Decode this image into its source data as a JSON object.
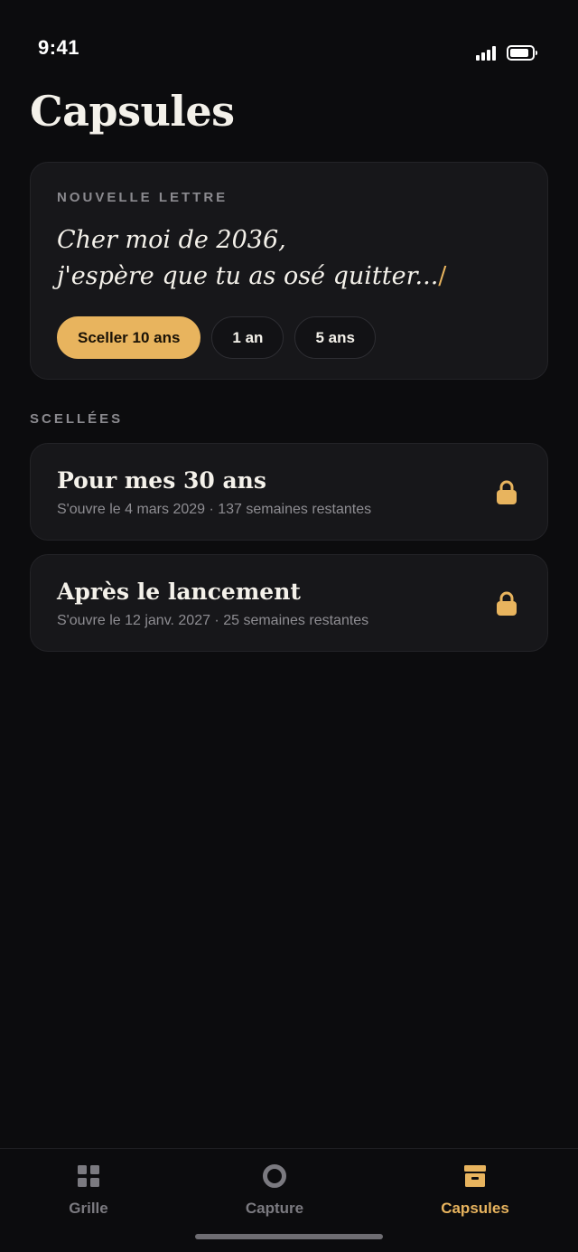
{
  "status": {
    "time": "9:41"
  },
  "page": {
    "title": "Capsules"
  },
  "composer": {
    "label": "NOUVELLE LETTRE",
    "line1": "Cher moi de 2036,",
    "line2": "j'espère que tu as osé quitter...",
    "caret": "/",
    "chips": [
      {
        "label": "Sceller 10 ans",
        "selected": true
      },
      {
        "label": "1 an",
        "selected": false
      },
      {
        "label": "5 ans",
        "selected": false
      }
    ]
  },
  "sealed": {
    "label": "SCELLÉES",
    "items": [
      {
        "title": "Pour mes 30 ans",
        "subtitle": "S'ouvre le 4 mars 2029 · 137 semaines restantes",
        "icon": "lock-icon"
      },
      {
        "title": "Après le lancement",
        "subtitle": "S'ouvre le 12 janv. 2027 · 25 semaines restantes",
        "icon": "lock-icon"
      }
    ]
  },
  "tabs": [
    {
      "label": "Grille",
      "icon": "grid-icon",
      "active": false
    },
    {
      "label": "Capture",
      "icon": "capture-icon",
      "active": false
    },
    {
      "label": "Capsules",
      "icon": "archive-box-icon",
      "active": true
    }
  ],
  "colors": {
    "accent": "#e8b45e",
    "background": "#0c0c0e",
    "card": "#17171a",
    "muted": "#8e8d92"
  },
  "battery_level": 0.85
}
